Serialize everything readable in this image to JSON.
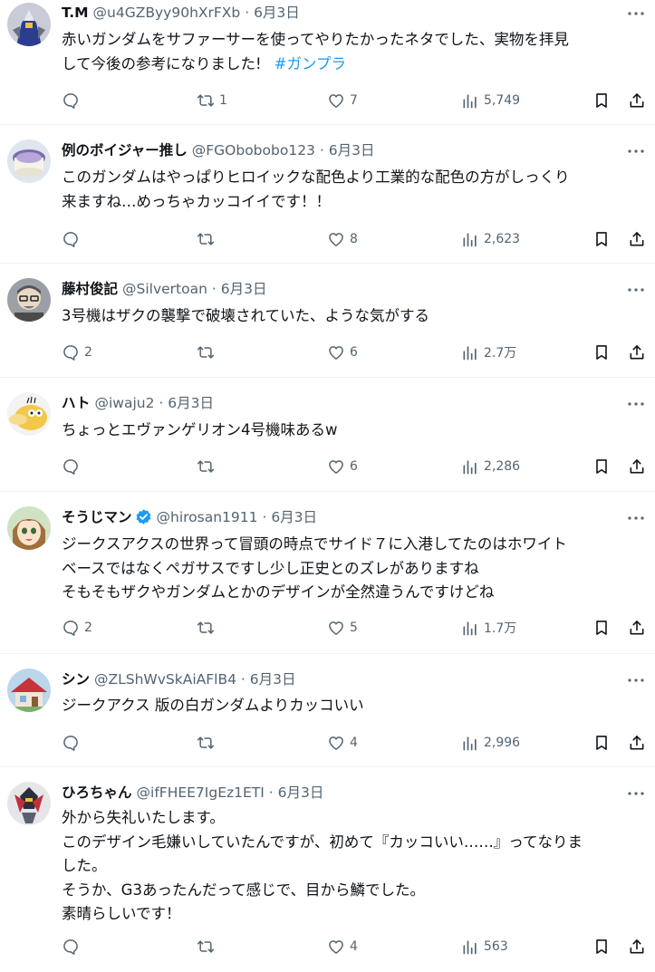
{
  "tweets": [
    {
      "name": "T.M",
      "handle": "@u4GZByy90hXrFXb",
      "date": "6月3日",
      "verified": false,
      "lines": [
        "赤いガンダムをサファーサーを使ってやりたかったネタでした、実物を拝見",
        "して今後の参考になりました!"
      ],
      "hashtag": "#ガンプラ",
      "reply": "",
      "retweet": "1",
      "like": "7",
      "views": "5,749"
    },
    {
      "name": "例のボイジャー推し",
      "handle": "@FGObobobo123",
      "date": "6月3日",
      "verified": false,
      "lines": [
        "このガンダムはやっぱりヒロイックな配色より工業的な配色の方がしっくり",
        "来ますね…めっちゃカッコイイです！！"
      ],
      "reply": "",
      "retweet": "",
      "like": "8",
      "views": "2,623"
    },
    {
      "name": "藤村俊記",
      "handle": "@Silvertoan",
      "date": "6月3日",
      "verified": false,
      "lines": [
        "3号機はザクの襲撃で破壊されていた、ような気がする"
      ],
      "reply": "2",
      "retweet": "",
      "like": "6",
      "views": "2.7万"
    },
    {
      "name": "ハト",
      "handle": "@iwaju2",
      "date": "6月3日",
      "verified": false,
      "lines": [
        "ちょっとエヴァンゲリオン4号機味あるw"
      ],
      "reply": "",
      "retweet": "",
      "like": "6",
      "views": "2,286"
    },
    {
      "name": "そうじマン",
      "handle": "@hirosan1911",
      "date": "6月3日",
      "verified": true,
      "lines": [
        "ジークスアクスの世界って冒頭の時点でサイド７に入港してたのはホワイト",
        "ベースではなくペガサスですし少し正史とのズレがありますね",
        "そもそもザクやガンダムとかのデザインが全然違うんですけどね"
      ],
      "reply": "2",
      "retweet": "",
      "like": "5",
      "views": "1.7万"
    },
    {
      "name": "シン",
      "handle": "@ZLShWvSkAiAFlB4",
      "date": "6月3日",
      "verified": false,
      "lines": [
        "ジークアクス 版の白ガンダムよりカッコいい"
      ],
      "reply": "",
      "retweet": "",
      "like": "4",
      "views": "2,996"
    },
    {
      "name": "ひろちゃん",
      "handle": "@ifFHEE7IgEz1ETI",
      "date": "6月3日",
      "verified": false,
      "lines": [
        "外から失礼いたします。",
        "このデザイン毛嫌いしていたんですが、初めて『カッコいい……』ってなりま",
        "した。",
        "そうか、G3あったんだって感じで、目から鱗でした。",
        "素晴らしいです！"
      ],
      "reply": "",
      "retweet": "",
      "like": "4",
      "views": "563"
    }
  ],
  "separator": "·",
  "colors": {
    "accent": "#1d9bf0",
    "secondary": "#536471",
    "text": "#0f1419",
    "border": "#eff3f4"
  }
}
